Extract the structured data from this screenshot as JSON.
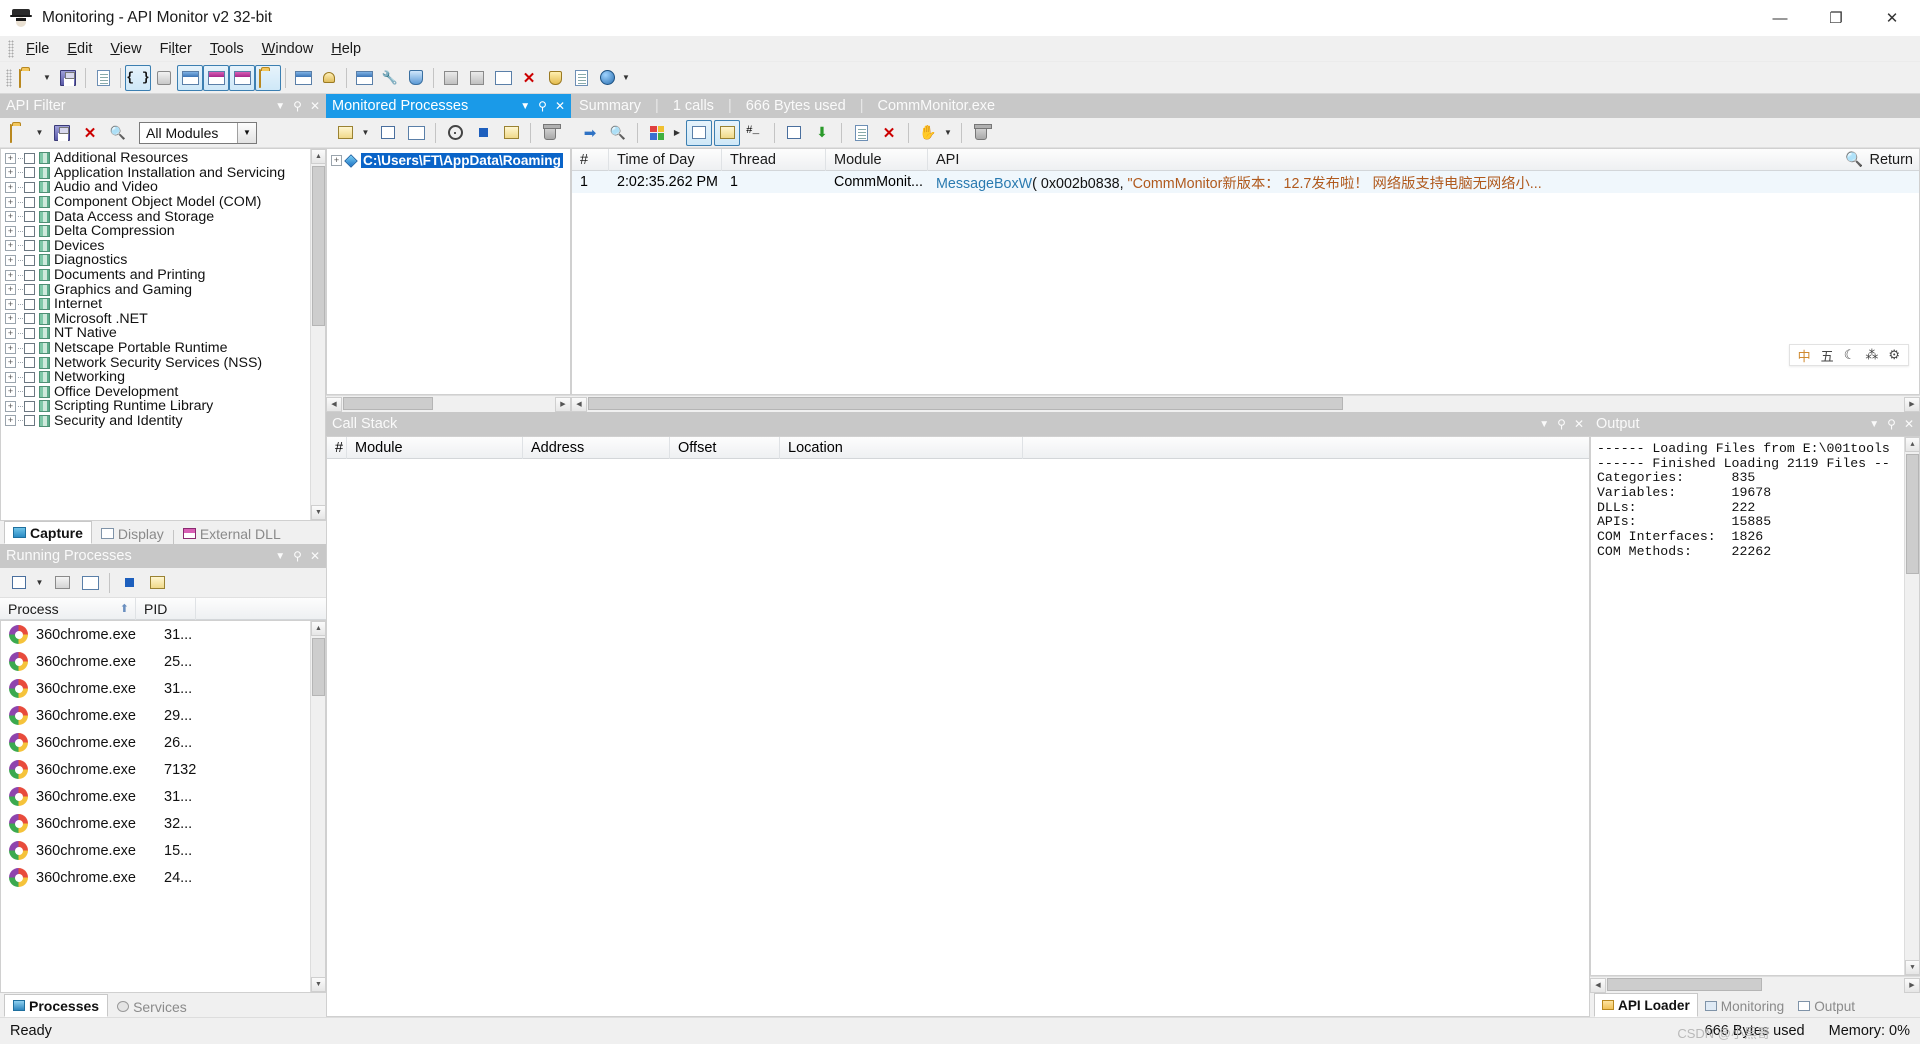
{
  "window": {
    "title": "Monitoring - API Monitor v2 32-bit",
    "app_icon": "spy-hat-icon",
    "controls": {
      "minimize": "—",
      "maximize": "❐",
      "close": "✕"
    }
  },
  "menubar": {
    "items": [
      "File",
      "Edit",
      "View",
      "Filter",
      "Tools",
      "Window",
      "Help"
    ]
  },
  "toolbar": {
    "items": [
      {
        "name": "open-file-icon",
        "glyph": "folder"
      },
      {
        "name": "open-dropdown-caret-icon",
        "glyph": "caret"
      },
      {
        "name": "save-icon",
        "glyph": "disk"
      },
      {
        "name": "copy-icon",
        "glyph": "doc"
      },
      {
        "name": "api-braces-icon",
        "glyph": "braces",
        "active": true
      },
      {
        "name": "hook-icon",
        "glyph": "hook"
      },
      {
        "name": "monitor-new-process-icon",
        "glyph": "monitor",
        "active": true
      },
      {
        "name": "window-pink-icon",
        "glyph": "winpink",
        "active": true
      },
      {
        "name": "window-pink-2-icon",
        "glyph": "winpink2",
        "active": true
      },
      {
        "name": "open-folders-icon",
        "glyph": "folders",
        "active": true
      },
      {
        "name": "summary-icon",
        "glyph": "monitor2"
      },
      {
        "name": "alert-bell-icon",
        "glyph": "bell"
      },
      {
        "name": "window-blue-icon",
        "glyph": "winblue"
      },
      {
        "name": "tools-wrench-icon",
        "glyph": "wrench"
      },
      {
        "name": "shield-icon",
        "glyph": "shield"
      },
      {
        "name": "hex-red-icon",
        "glyph": "hexred"
      },
      {
        "name": "hex-red-2-icon",
        "glyph": "hexred2"
      },
      {
        "name": "window-gray-icon",
        "glyph": "wingray"
      },
      {
        "name": "red-x-tool-icon",
        "glyph": "redx"
      },
      {
        "name": "shield-yellow-icon",
        "glyph": "shieldy"
      },
      {
        "name": "page-blue-icon",
        "glyph": "pageblue"
      },
      {
        "name": "help-icon",
        "glyph": "help"
      },
      {
        "name": "toolbar-overflow-icon",
        "glyph": "overflow"
      }
    ]
  },
  "api_filter": {
    "caption": "API Filter",
    "toolbar": [
      {
        "name": "open-filter-icon"
      },
      {
        "name": "open-filter-caret-icon"
      },
      {
        "name": "save-filter-icon"
      },
      {
        "name": "clear-filter-icon"
      },
      {
        "name": "find-api-icon"
      }
    ],
    "module_select": {
      "value": "All Modules",
      "placeholder": "All Modules"
    },
    "tree_items": [
      "Additional Resources",
      "Application Installation and Servicing",
      "Audio and Video",
      "Component Object Model (COM)",
      "Data Access and Storage",
      "Delta Compression",
      "Devices",
      "Diagnostics",
      "Documents and Printing",
      "Graphics and Gaming",
      "Internet",
      "Microsoft .NET",
      "NT Native",
      "Netscape Portable Runtime",
      "Network Security Services (NSS)",
      "Networking",
      "Office Development",
      "Scripting Runtime Library",
      "Security and Identity"
    ],
    "tabs": [
      {
        "label": "Capture",
        "selected": true,
        "icon": "capture-icon"
      },
      {
        "label": "Display",
        "selected": false,
        "icon": "display-icon"
      },
      {
        "label": "External DLL",
        "selected": false,
        "icon": "external-dll-icon"
      }
    ]
  },
  "running_processes": {
    "caption": "Running Processes",
    "toolbar": [
      {
        "name": "start-monitoring-icon"
      },
      {
        "name": "start-monitoring-caret-icon"
      },
      {
        "name": "process-properties-icon"
      },
      {
        "name": "stop-monitoring-icon"
      },
      {
        "name": "attach-process-icon"
      },
      {
        "name": "process-details-icon"
      }
    ],
    "columns": [
      "Process",
      "PID"
    ],
    "sort_indicator": "⬆",
    "rows": [
      {
        "process": "360chrome.exe",
        "pid": "31..."
      },
      {
        "process": "360chrome.exe",
        "pid": "25..."
      },
      {
        "process": "360chrome.exe",
        "pid": "31..."
      },
      {
        "process": "360chrome.exe",
        "pid": "29..."
      },
      {
        "process": "360chrome.exe",
        "pid": "26..."
      },
      {
        "process": "360chrome.exe",
        "pid": "7132"
      },
      {
        "process": "360chrome.exe",
        "pid": "31..."
      },
      {
        "process": "360chrome.exe",
        "pid": "32..."
      },
      {
        "process": "360chrome.exe",
        "pid": "15..."
      },
      {
        "process": "360chrome.exe",
        "pid": "24..."
      }
    ],
    "tabs": [
      {
        "label": "Processes",
        "selected": true,
        "icon": "processes-icon"
      },
      {
        "label": "Services",
        "selected": false,
        "icon": "services-icon"
      }
    ]
  },
  "monitored_processes": {
    "caption": "Monitored Processes",
    "toolbar": [
      {
        "name": "start-monitor-icon"
      },
      {
        "name": "start-monitor-caret-icon"
      },
      {
        "name": "resume-icon"
      },
      {
        "name": "stop-process-icon"
      },
      {
        "name": "target-crosshair-icon"
      },
      {
        "name": "attach-icon"
      },
      {
        "name": "properties-icon"
      },
      {
        "name": "delete-icon"
      }
    ],
    "item": {
      "path": "C:\\Users\\FT\\AppData\\Roaming",
      "expander": "+",
      "icon": "gem-icon"
    }
  },
  "summary": {
    "label": "Summary",
    "calls": "1 calls",
    "bytes": "666 Bytes used",
    "process": "CommMonitor.exe",
    "separator": "|",
    "toolbar": [
      {
        "name": "goto-icon"
      },
      {
        "name": "find-icon"
      },
      {
        "name": "color-legend-icon"
      },
      {
        "name": "color-legend-caret-icon"
      },
      {
        "name": "tree-view-icon",
        "active": true
      },
      {
        "name": "details-view-icon",
        "active": true
      },
      {
        "name": "hex-display-icon"
      },
      {
        "name": "columns-icon"
      },
      {
        "name": "export-icon"
      },
      {
        "name": "clear-api-icon"
      },
      {
        "name": "clear-buffer-icon"
      },
      {
        "name": "pause-icon"
      },
      {
        "name": "pause-caret-icon"
      },
      {
        "name": "trash-icon"
      }
    ],
    "columns": [
      "#",
      "Time of Day",
      "Thread",
      "Module",
      "API"
    ],
    "return_label": "Return",
    "search_icon": "search-icon",
    "rows": [
      {
        "num": "1",
        "time": "2:02:35.262 PM",
        "thread": "1",
        "module": "CommMonit...",
        "api_name": "MessageBoxW",
        "api_args": "( 0x002b0838, ",
        "api_string": "\"CommMonitor新版本： 12.7发布啦！ 网络版支持电脑无网络小...",
        "api_tail": ""
      }
    ],
    "ime_bar": [
      "中",
      "五",
      "☾",
      "⁂",
      "⚙"
    ]
  },
  "call_stack": {
    "caption": "Call Stack",
    "columns": [
      "#",
      "Module",
      "Address",
      "Offset",
      "Location"
    ],
    "rows": []
  },
  "output": {
    "caption": "Output",
    "lines": [
      "------ Loading Files from E:\\001tools",
      "------ Finished Loading 2119 Files --",
      "Categories:      835",
      "Variables:       19678",
      "DLLs:            222",
      "APIs:            15885",
      "COM Interfaces:  1826",
      "COM Methods:     22262"
    ],
    "tabs": [
      {
        "label": "API Loader",
        "selected": true,
        "icon": "api-loader-icon"
      },
      {
        "label": "Monitoring",
        "selected": false,
        "icon": "monitoring-icon"
      },
      {
        "label": "Output",
        "selected": false,
        "icon": "output-icon"
      }
    ]
  },
  "statusbar": {
    "message": "Ready",
    "bytes_used": "666 Bytes used",
    "memory": "Memory: 0%"
  },
  "watermark": "CSDN @小黑哥",
  "colors": {
    "caption_active": "#1a9ae8",
    "caption_inactive": "#c8c8c8",
    "api_name": "#2a7ab0",
    "api_string": "#b05a1e",
    "selection": "#0a64c8",
    "row_highlight": "#f0f7fc"
  }
}
